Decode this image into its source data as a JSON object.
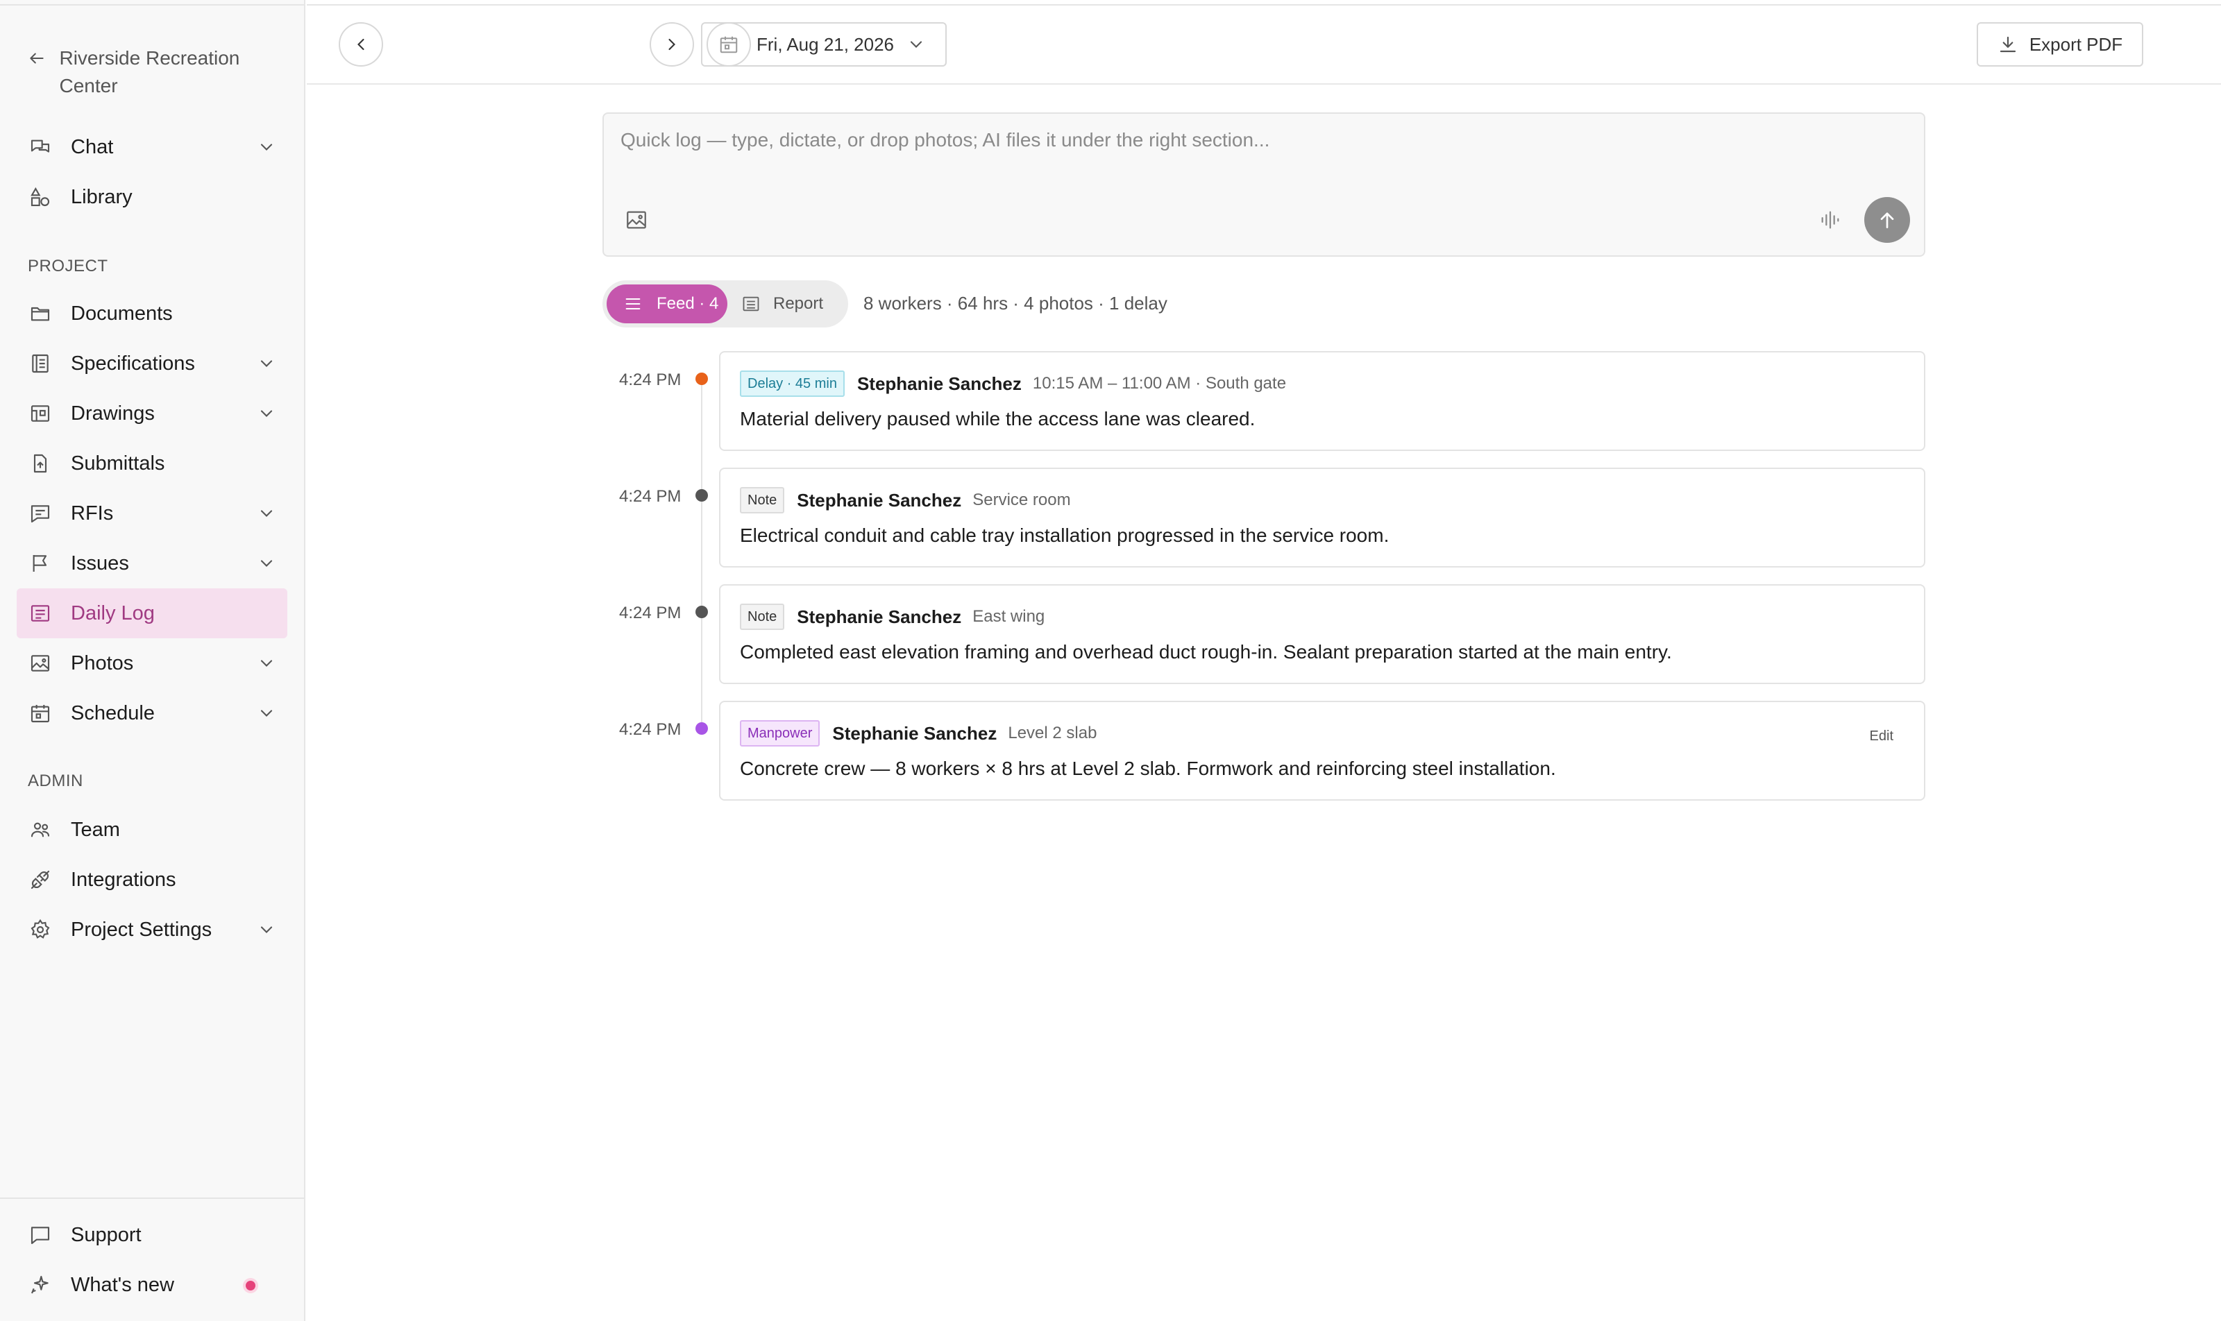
{
  "sidebar": {
    "back_label": "Riverside Recreation Center",
    "top_items": [
      {
        "label": "Chat"
      },
      {
        "label": "Library"
      }
    ],
    "project_section": "PROJECT",
    "project_items": [
      {
        "label": "Documents"
      },
      {
        "label": "Specifications"
      },
      {
        "label": "Drawings"
      },
      {
        "label": "Submittals"
      },
      {
        "label": "RFIs"
      },
      {
        "label": "Issues"
      },
      {
        "label": "Daily Log"
      },
      {
        "label": "Photos"
      },
      {
        "label": "Schedule"
      }
    ],
    "admin_section": "ADMIN",
    "admin_items": [
      {
        "label": "Team"
      },
      {
        "label": "Integrations"
      },
      {
        "label": "Project Settings"
      }
    ],
    "bottom_items": [
      {
        "label": "Support"
      },
      {
        "label": "What's new"
      }
    ]
  },
  "toolbar": {
    "date_label": "Fri, Aug 21, 2026",
    "export_label": "Export PDF"
  },
  "quick_log": {
    "placeholder": "Quick log — type, dictate, or drop photos; AI files it under the right section..."
  },
  "view_toggle": {
    "feed_label": "Feed · 4",
    "report_label": "Report"
  },
  "summary": "8 workers · 64 hrs · 4 photos · 1 delay",
  "colors": {
    "accent": "#c556ad",
    "delay_dot": "#e8621a",
    "note_dot": "#555555",
    "manpower_dot": "#a855e6"
  },
  "entries": [
    {
      "time": "4:24 PM",
      "badge": "Delay · 45 min",
      "author": "Stephanie Sanchez",
      "meta": "10:15 AM – 11:00 AM · South gate",
      "text": "Material delivery paused while the access lane was cleared."
    },
    {
      "time": "4:24 PM",
      "badge": "Note",
      "author": "Stephanie Sanchez",
      "meta": "Service room",
      "text": "Electrical conduit and cable tray installation progressed in the service room."
    },
    {
      "time": "4:24 PM",
      "badge": "Note",
      "author": "Stephanie Sanchez",
      "meta": "East wing",
      "text": "Completed east elevation framing and overhead duct rough-in. Sealant preparation started at the main entry."
    },
    {
      "time": "4:24 PM",
      "badge": "Manpower",
      "author": "Stephanie Sanchez",
      "meta": "Level 2 slab",
      "text": "Concrete crew — 8 workers × 8 hrs at Level 2 slab. Formwork and reinforcing steel installation.",
      "edit_label": "Edit"
    }
  ]
}
